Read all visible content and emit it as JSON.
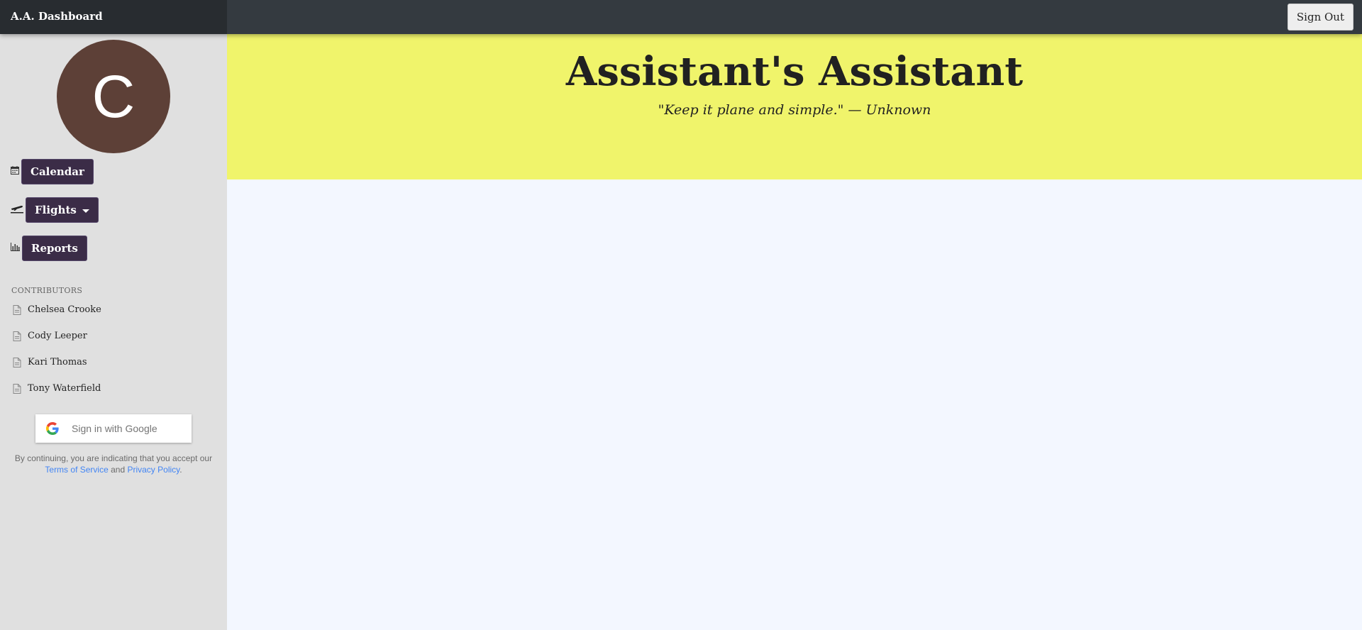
{
  "topbar": {
    "brand": "A.A. Dashboard",
    "signout_label": "Sign Out"
  },
  "sidebar": {
    "avatar_letter": "C",
    "nav": [
      {
        "label": "Calendar",
        "icon": "calendar-icon"
      },
      {
        "label": "Flights",
        "icon": "plane-icon",
        "dropdown": true
      },
      {
        "label": "Reports",
        "icon": "chart-icon"
      }
    ],
    "contributors_heading": "CONTRIBUTORS",
    "contributors": [
      "Chelsea Crooke",
      "Cody Leeper",
      "Kari Thomas",
      "Tony Waterfield"
    ],
    "google_signin_label": "Sign in with Google",
    "legal": {
      "prefix": "By continuing, you are indicating that you accept our",
      "terms": "Terms of Service",
      "and": "and",
      "privacy": "Privacy Policy",
      "suffix": "."
    }
  },
  "hero": {
    "title": "Assistant's Assistant",
    "quote": "\"Keep it plane and simple.\" — Unknown"
  },
  "colors": {
    "topbar": "#343a40",
    "brand_bg": "#282c30",
    "sidebar": "#e0e0e0",
    "avatar": "#5d4037",
    "nav_button": "#3b2c47",
    "hero": "#f0f46b",
    "main": "#f3f7ff",
    "link": "#4285f4"
  }
}
